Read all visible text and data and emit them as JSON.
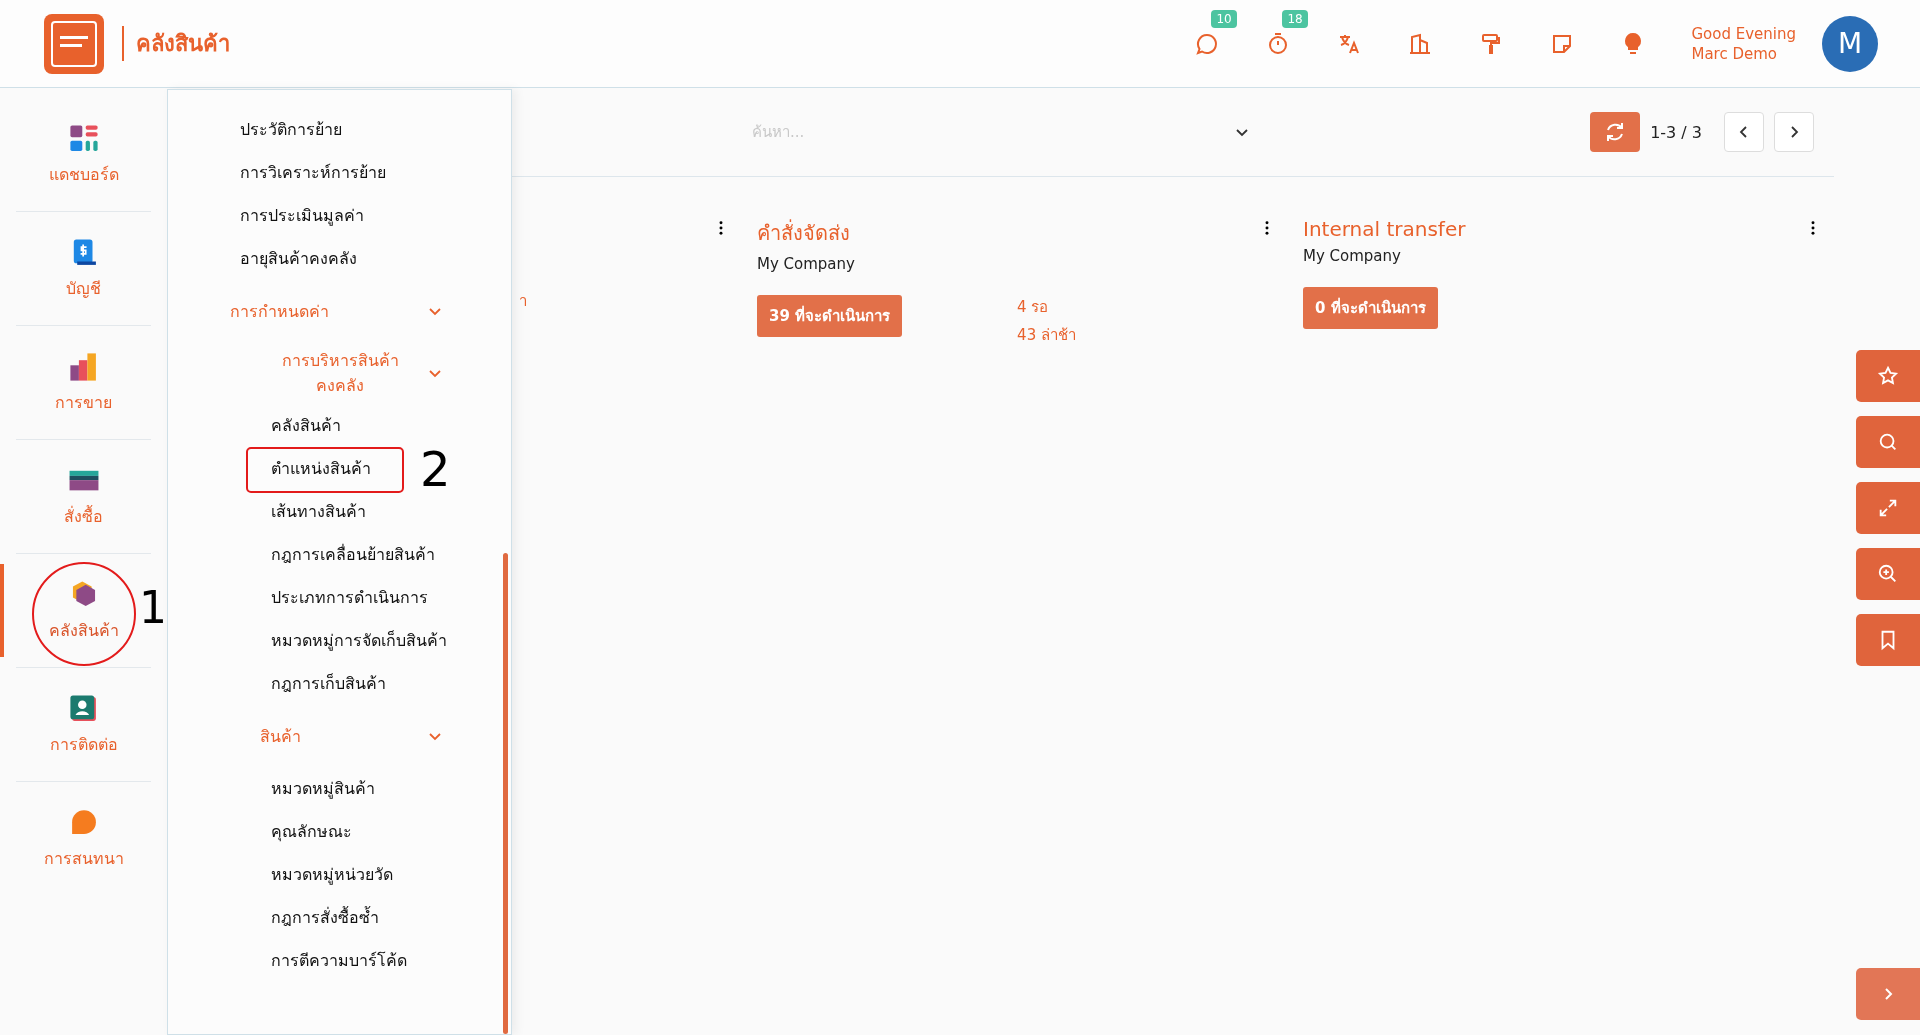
{
  "header": {
    "app_title": "คลังสินค้า",
    "badges": [
      {
        "kind": "chat",
        "count": "10"
      },
      {
        "kind": "timer",
        "count": "18"
      },
      {
        "kind": "translate"
      },
      {
        "kind": "building"
      },
      {
        "kind": "roller"
      },
      {
        "kind": "note"
      },
      {
        "kind": "bulb"
      }
    ],
    "greeting": "Good Evening",
    "user_name": "Marc Demo",
    "avatar_letter": "M"
  },
  "rail": [
    {
      "kind": "dashboard",
      "label": "แดชบอร์ด",
      "selected": false
    },
    {
      "kind": "accounting",
      "label": "บัญชี",
      "selected": false
    },
    {
      "kind": "sales",
      "label": "การขาย",
      "selected": false
    },
    {
      "kind": "purchase",
      "label": "สั่งซื้อ",
      "selected": false
    },
    {
      "kind": "inventory",
      "label": "คลังสินค้า",
      "selected": true,
      "annotation": "1"
    },
    {
      "kind": "contacts",
      "label": "การติดต่อ",
      "selected": false
    },
    {
      "kind": "chat",
      "label": "การสนทนา",
      "selected": false
    }
  ],
  "menu": [
    {
      "label": "ประวัติการย้าย"
    },
    {
      "label": "การวิเคราะห์การย้าย"
    },
    {
      "label": "การประเมินมูลค่า"
    },
    {
      "label": "อายุสินค้าคงคลัง"
    },
    {
      "label": "การกำหนดค่า",
      "expanded": true,
      "children": [
        {
          "label": "การบริหารสินค้าคงคลัง",
          "expanded": true,
          "children": [
            {
              "label": "คลังสินค้า"
            },
            {
              "label": "ตำแหน่งสินค้า",
              "annotation": "2"
            },
            {
              "label": "เส้นทางสินค้า"
            },
            {
              "label": "กฎการเคลื่อนย้ายสินค้า"
            },
            {
              "label": "ประเภทการดำเนินการ"
            },
            {
              "label": "หมวดหมู่การจัดเก็บสินค้า"
            },
            {
              "label": "กฎการเก็บสินค้า"
            }
          ]
        },
        {
          "label": "สินค้า",
          "expanded": true,
          "children": [
            {
              "label": "หมวดหมู่สินค้า"
            },
            {
              "label": "คุณลักษณะ"
            },
            {
              "label": "หมวดหมู่หน่วยวัด"
            },
            {
              "label": "กฎการสั่งซื้อซ้ำ"
            },
            {
              "label": "การตีความบาร์โค้ด"
            }
          ]
        }
      ]
    }
  ],
  "search": {
    "placeholder": "ค้นหา..."
  },
  "pager": {
    "range": "1-3 / 3"
  },
  "cards": [
    {
      "fragment": "า"
    },
    {
      "title": "คำสั่งจัดส่ง",
      "company": "My Company",
      "action": "39 ที่จะดำเนินการ",
      "stats": [
        "4 รอ",
        "43 ล่าช้า"
      ]
    },
    {
      "title": "Internal transfer",
      "company": "My Company",
      "action": "0 ที่จะดำเนินการ"
    }
  ],
  "side_tools": [
    {
      "kind": "star"
    },
    {
      "kind": "search"
    },
    {
      "kind": "expand"
    },
    {
      "kind": "zoom-in"
    },
    {
      "kind": "bookmark"
    }
  ]
}
